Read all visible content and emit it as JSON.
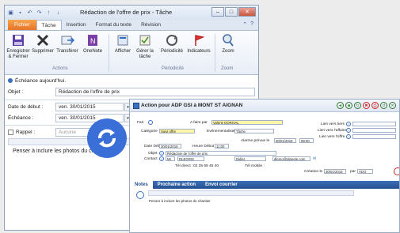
{
  "win1": {
    "title": "Rédaction de l'offre de prix - Tâche",
    "tabs": [
      "Fichier",
      "Tâche",
      "Insertion",
      "Format du texte",
      "Révision"
    ],
    "ribbon": {
      "buttons": [
        "Enregistrer & Fermer",
        "Supprimer",
        "Transférer",
        "OneNote",
        "Afficher",
        "Gérer la tâche",
        "Périodicité",
        "Indicateurs",
        "Zoom"
      ],
      "groups": [
        "Actions",
        "Périodicité",
        "Zoom"
      ]
    },
    "info": "Échéance aujourd'hui.",
    "fields": {
      "objet_label": "Objet :",
      "objet_value": "Rédaction de l'offre de prix",
      "debut_label": "Date de début :",
      "debut_value": "ven. 30/01/2015",
      "echeance_label": "Échéance :",
      "echeance_value": "ven. 30/01/2015",
      "rappel_label": "Rappel :",
      "rappel_value": "Aucune"
    },
    "body_text": "Penser à inclure les photos du chantier"
  },
  "win2": {
    "title": "Action pour ADP GSI à MONT ST AIGNAN",
    "labels": {
      "fait": "Fait",
      "afaire": "A faire par",
      "categorie": "Catégorie",
      "evenement": "Evénementaliste",
      "alarme": "Alarme prévue le",
      "date_debut": "Date Début",
      "heure_debut": "Heure Début",
      "objet": "Objet",
      "contact": "Contact",
      "telDirect": "Tél direct :",
      "telMobile": "Tél mobile :",
      "lien_tiers": "Lien vers tiers",
      "lien_affaire": "Lien vers l'affaire",
      "lien_offre": "Lien vers l'offre",
      "creation": "Création le",
      "par": "par"
    },
    "values": {
      "afaire": "Valérie DORIVAL",
      "categorie": "Suivi offre",
      "evenement": "Tâche",
      "alarme_date": "30/01/2015",
      "alarme_time": "08:00",
      "date_debut": "30/01/2015",
      "heure_debut": "11:00",
      "objet": "Rédaction de l'offre de prix",
      "contact_civ": "Mr",
      "contact_nom": "DLEGRIS",
      "contact_prenom": "Didier",
      "email": "dlemo@planete.com",
      "tel": "02 35 69 45 40",
      "creation_date": "30/01/2015",
      "creation_par": "VDO"
    },
    "tabs": [
      "Notes",
      "Prochaine action",
      "Envoi courrier"
    ],
    "body_text": "Penser à inclure les photos du chantier"
  },
  "colors": {
    "accent": "#3a6fd8",
    "file_tab": "#e6742a",
    "bar_blue": "#24508f"
  }
}
